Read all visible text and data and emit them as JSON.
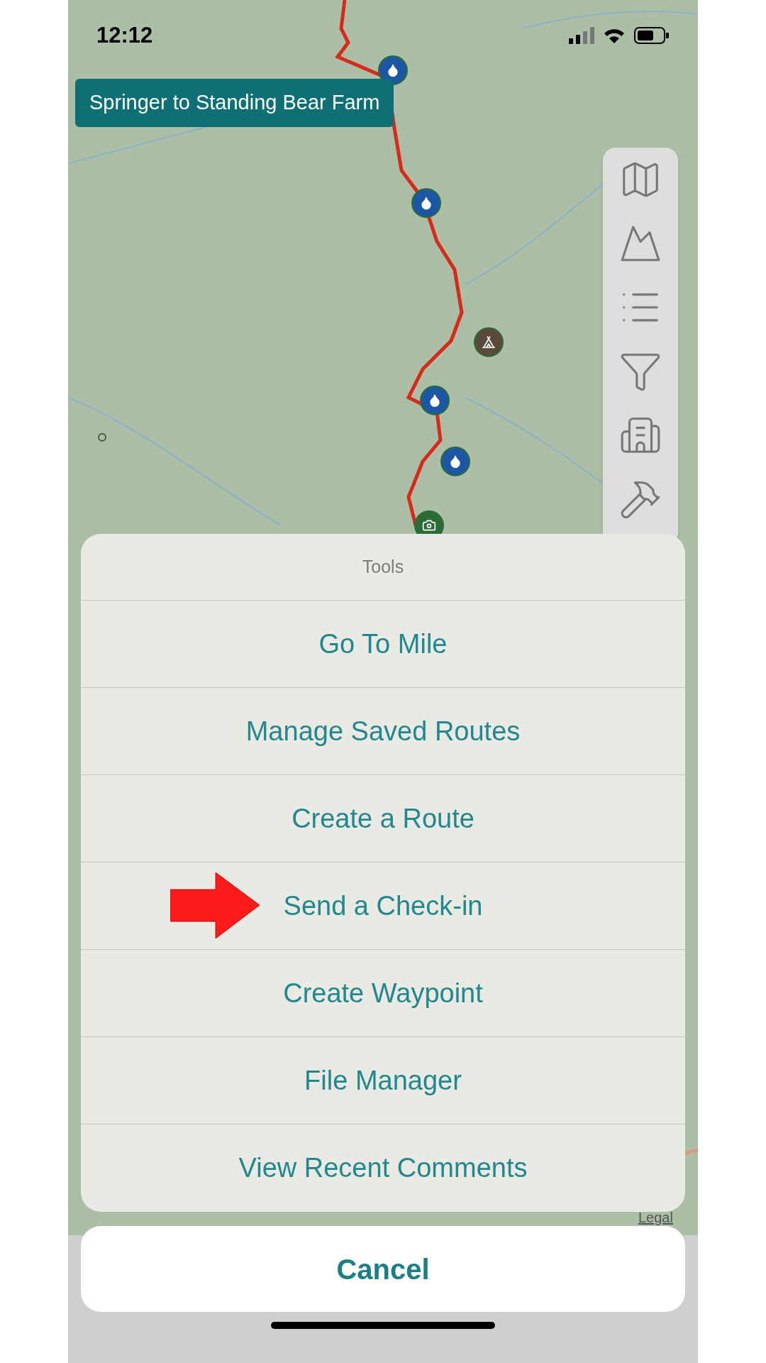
{
  "status_bar": {
    "time": "12:12"
  },
  "route_label": "Springer to Standing Bear Farm",
  "map": {
    "attribution": "Legal"
  },
  "action_sheet": {
    "title": "Tools",
    "items": [
      {
        "label": "Go To Mile",
        "arrow": false
      },
      {
        "label": "Manage Saved Routes",
        "arrow": false
      },
      {
        "label": "Create a Route",
        "arrow": false
      },
      {
        "label": "Send a Check-in",
        "arrow": true
      },
      {
        "label": "Create Waypoint",
        "arrow": false
      },
      {
        "label": "File Manager",
        "arrow": false
      },
      {
        "label": "View Recent Comments",
        "arrow": false
      }
    ],
    "cancel": "Cancel"
  }
}
